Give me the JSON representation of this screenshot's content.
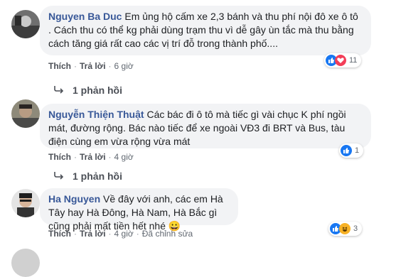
{
  "comments": [
    {
      "author": "Nguyen Ba Duc",
      "text": "Em ủng hộ cấm xe 2,3 bánh và thu phí nội đô xe ô tô . Cách thu có thể kg phải dùng trạm thu vì dễ gây ùn tắc mà thu bằng cách tăng giá rất cao các vị trí đỗ trong thành phố....",
      "like_label": "Thích",
      "reply_label": "Trả lời",
      "time": "6 giờ",
      "reaction_count": "11",
      "reactions": [
        "like-icon",
        "love-icon"
      ],
      "replies_label": "1 phản hồi"
    },
    {
      "author": "Nguyễn Thiện Thuật",
      "text": "Các bác đi ô tô mà tiếc gì vài chục K phí ngồi mát, đường rộng. Bác nào tiếc để xe ngoài VĐ3 đi BRT và Bus, tàu điện cùng em vừa rộng vừa mát",
      "like_label": "Thích",
      "reply_label": "Trả lời",
      "time": "4 giờ",
      "reaction_count": "1",
      "reactions": [
        "like-icon"
      ],
      "replies_label": "1 phản hồi"
    },
    {
      "author": "Ha Nguyen",
      "text": "Về đây với anh, các em Hà Tây hay Hà Đông, Hà Nam, Hà Bắc gì cũng phải mất tiền hết nhé",
      "emoji": "😀",
      "like_label": "Thích",
      "reply_label": "Trả lời",
      "time": "4 giờ",
      "edited_label": "Đã chỉnh sửa",
      "reaction_count": "3",
      "reactions": [
        "like-icon",
        "haha-icon"
      ]
    }
  ],
  "colors": {
    "author": "#385898",
    "bubble": "#f2f3f5",
    "like": "#1877f2",
    "love": "#f33e58",
    "haha": "#f7b125"
  }
}
